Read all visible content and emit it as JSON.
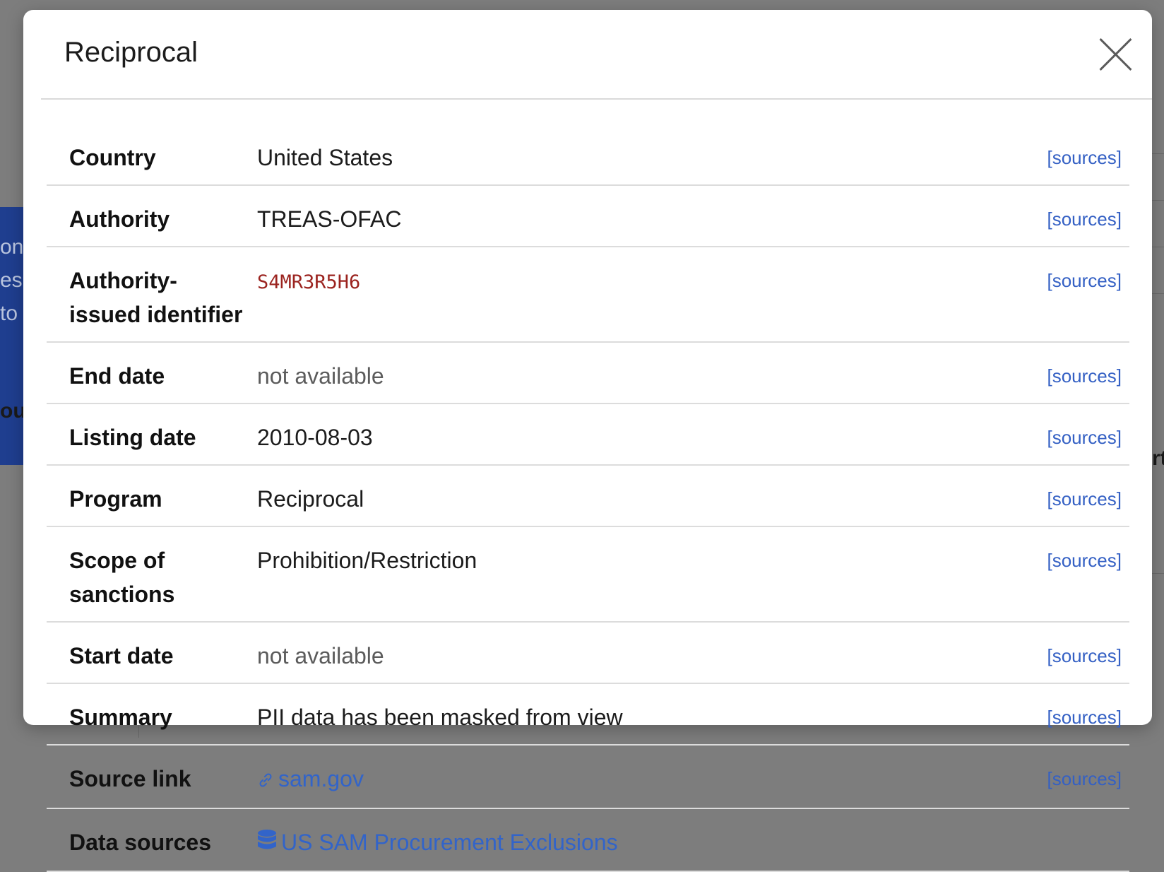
{
  "modal": {
    "title": "Reciprocal",
    "close_icon": "close-icon"
  },
  "background_fragments": {
    "line1": "on-",
    "line2": "es",
    "line3": "to",
    "bold_left": "ou",
    "bold_right": "rt"
  },
  "colors": {
    "link": "#3460c4",
    "identifier": "#9b231f",
    "overlay": "#7d7d7d",
    "background_accent": "#1f3e8f"
  },
  "properties": [
    {
      "key": "Country",
      "value": "United States",
      "sources": "[sources]"
    },
    {
      "key": "Authority",
      "value": "TREAS-OFAC",
      "sources": "[sources]"
    },
    {
      "key": "Authority-issued identifier",
      "value": "S4MR3R5H6",
      "sources": "[sources]"
    },
    {
      "key": "End date",
      "value": "not available",
      "sources": "[sources]"
    },
    {
      "key": "Listing date",
      "value": "2010-08-03",
      "sources": "[sources]"
    },
    {
      "key": "Program",
      "value": "Reciprocal",
      "sources": "[sources]"
    },
    {
      "key": "Scope of sanctions",
      "value": "Prohibition/Restriction",
      "sources": "[sources]"
    },
    {
      "key": "Start date",
      "value": "not available",
      "sources": "[sources]"
    },
    {
      "key": "Summary",
      "value": "PII data has been masked from view",
      "sources": "[sources]"
    },
    {
      "key": "Source link",
      "value": "sam.gov",
      "icon": "link-icon",
      "sources": "[sources]"
    },
    {
      "key": "Data sources",
      "value": "US SAM Procurement Exclusions",
      "icon": "database-icon"
    }
  ]
}
